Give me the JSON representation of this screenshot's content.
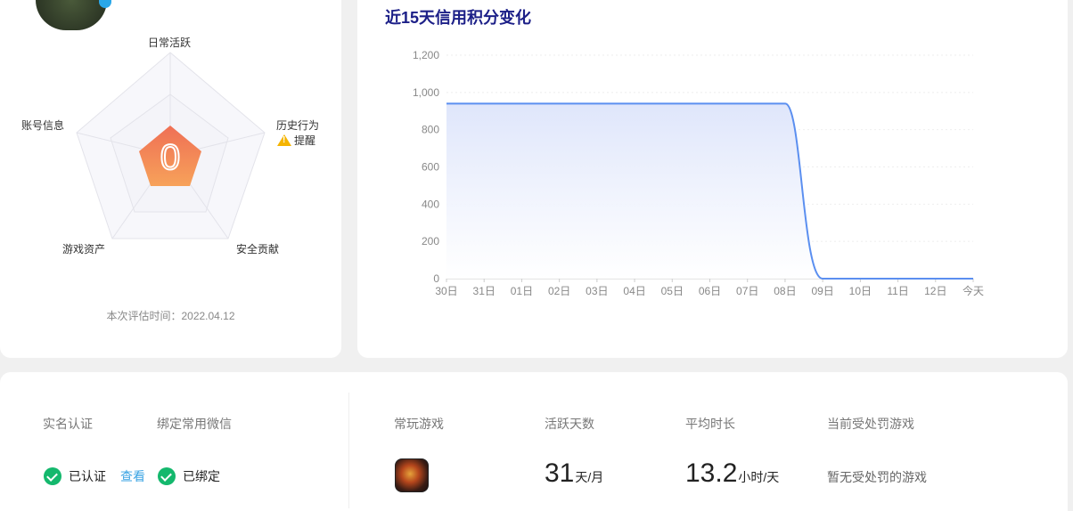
{
  "radar": {
    "labels": {
      "daily_activity": "日常活跃",
      "history_behavior": "历史行为",
      "security_contribution": "安全贡献",
      "game_assets": "游戏资产",
      "account_info": "账号信息"
    },
    "warning_text": "提醒",
    "score": "0",
    "evaluation_time": "本次评估时间：2022.04.12"
  },
  "chart": {
    "title": "近15天信用积分变化"
  },
  "chart_data": {
    "type": "area",
    "title": "近15天信用积分变化",
    "xlabel": "",
    "ylabel": "",
    "categories": [
      "30日",
      "31日",
      "01日",
      "02日",
      "03日",
      "04日",
      "05日",
      "06日",
      "07日",
      "08日",
      "09日",
      "10日",
      "11日",
      "12日",
      "今天"
    ],
    "values": [
      940,
      940,
      940,
      940,
      940,
      940,
      940,
      940,
      940,
      940,
      0,
      0,
      0,
      0,
      0
    ],
    "y_ticks": [
      "0",
      "200",
      "400",
      "600",
      "800",
      "1,000",
      "1,200"
    ],
    "ylim": [
      0,
      1200
    ],
    "grid": true,
    "color": "#5b8ff0"
  },
  "account": {
    "realname_label": "实名认证",
    "realname_status": "已认证",
    "view_link": "查看",
    "wechat_label": "绑定常用微信",
    "wechat_status": "已绑定"
  },
  "games": {
    "frequent_label": "常玩游戏",
    "active_days_label": "活跃天数",
    "active_days_value": "31",
    "active_days_unit": "天/月",
    "avg_time_label": "平均时长",
    "avg_time_value": "13.2",
    "avg_time_unit": "小时/天",
    "penalty_label": "当前受处罚游戏",
    "penalty_value": "暂无受处罚的游戏"
  }
}
